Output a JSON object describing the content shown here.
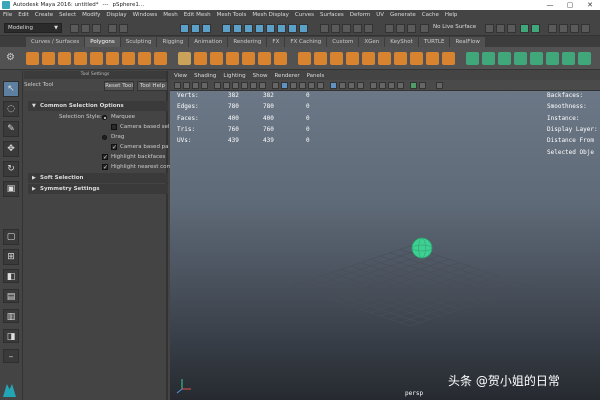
{
  "window": {
    "title": "Autodesk Maya 2016: untitled*",
    "separator": "---",
    "selection": "pSphere1...",
    "controls": [
      "—",
      "▢",
      "✕"
    ]
  },
  "menubar": [
    "File",
    "Edit",
    "Create",
    "Select",
    "Modify",
    "Display",
    "Windows",
    "Mesh",
    "Edit Mesh",
    "Mesh Tools",
    "Mesh Display",
    "Curves",
    "Surfaces",
    "Deform",
    "UV",
    "Generate",
    "Cache",
    "Help"
  ],
  "statusline": {
    "mode": "Modeling",
    "live_surface": "No Live Surface"
  },
  "shelf_tabs": [
    "Curves / Surfaces",
    "Polygons",
    "Sculpting",
    "Rigging",
    "Animation",
    "Rendering",
    "FX",
    "FX Caching",
    "Custom",
    "XGen",
    "KeyShot",
    "TURTLE",
    "RealFlow"
  ],
  "active_shelf_tab": "Polygons",
  "tool_settings": {
    "panel_title": "Tool Settings",
    "tool_name": "Select Tool",
    "reset_button": "Reset Tool",
    "help_button": "Tool Help",
    "sections": {
      "common": "Common Selection Options",
      "soft": "Soft Selection",
      "symmetry": "Symmetry Settings"
    },
    "selection_style_label": "Selection Style:",
    "marquee": "Marquee",
    "camera_based_sel": "Camera based sel",
    "drag": "Drag",
    "camera_based_pa": "Camera based pa",
    "highlight_backfaces": "Highlight backfaces",
    "highlight_nearest": "Highlight nearest com"
  },
  "viewport": {
    "menu": [
      "View",
      "Shading",
      "Lighting",
      "Show",
      "Renderer",
      "Panels"
    ],
    "hud_stats": [
      {
        "label": "Verts:",
        "a": "382",
        "b": "382",
        "c": "0"
      },
      {
        "label": "Edges:",
        "a": "780",
        "b": "780",
        "c": "0"
      },
      {
        "label": "Faces:",
        "a": "400",
        "b": "400",
        "c": "0"
      },
      {
        "label": "Tris:",
        "a": "760",
        "b": "760",
        "c": "0"
      },
      {
        "label": "UVs:",
        "a": "439",
        "b": "439",
        "c": "0"
      }
    ],
    "hud_right": [
      "Backfaces:",
      "Smoothness:",
      "Instance:",
      "Display Layer:",
      "Distance From",
      "Selected Obje"
    ],
    "camera": "persp"
  },
  "watermark": "头条 @贺小姐的日常",
  "colors": {
    "sphere": "#3fcf92",
    "accent_blue": "#5d7fa0",
    "viewport_top": "#6e7a89",
    "viewport_bottom": "#262a30"
  }
}
